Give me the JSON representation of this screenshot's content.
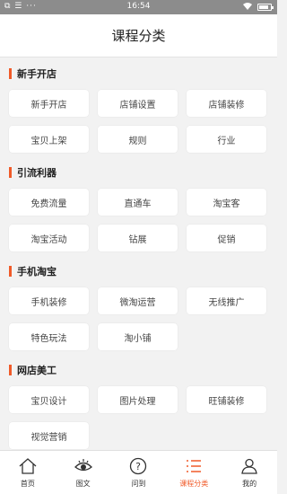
{
  "status_bar": {
    "left_icons": "⧉ ☰ ···",
    "time": "16:54",
    "battery_level": 0.85
  },
  "header": {
    "title": "课程分类"
  },
  "accent_color": "#f05a28",
  "sections": [
    {
      "title": "新手开店",
      "items": [
        "新手开店",
        "店铺设置",
        "店铺装修",
        "宝贝上架",
        "规则",
        "行业"
      ]
    },
    {
      "title": "引流利器",
      "items": [
        "免费流量",
        "直通车",
        "淘宝客",
        "淘宝活动",
        "钻展",
        "促销"
      ]
    },
    {
      "title": "手机淘宝",
      "items": [
        "手机装修",
        "微淘运营",
        "无线推广",
        "特色玩法",
        "淘小铺"
      ]
    },
    {
      "title": "网店美工",
      "items": [
        "宝贝设计",
        "图片处理",
        "旺铺装修",
        "视觉营销"
      ]
    }
  ],
  "tabbar": {
    "home": {
      "label": "首页",
      "icon": "home-icon"
    },
    "graphic": {
      "label": "图文",
      "icon": "eye-icon"
    },
    "ask": {
      "label": "问到",
      "icon": "question-icon"
    },
    "category": {
      "label": "课程分类",
      "icon": "list-icon",
      "active": true
    },
    "mine": {
      "label": "我的",
      "icon": "person-icon"
    }
  }
}
